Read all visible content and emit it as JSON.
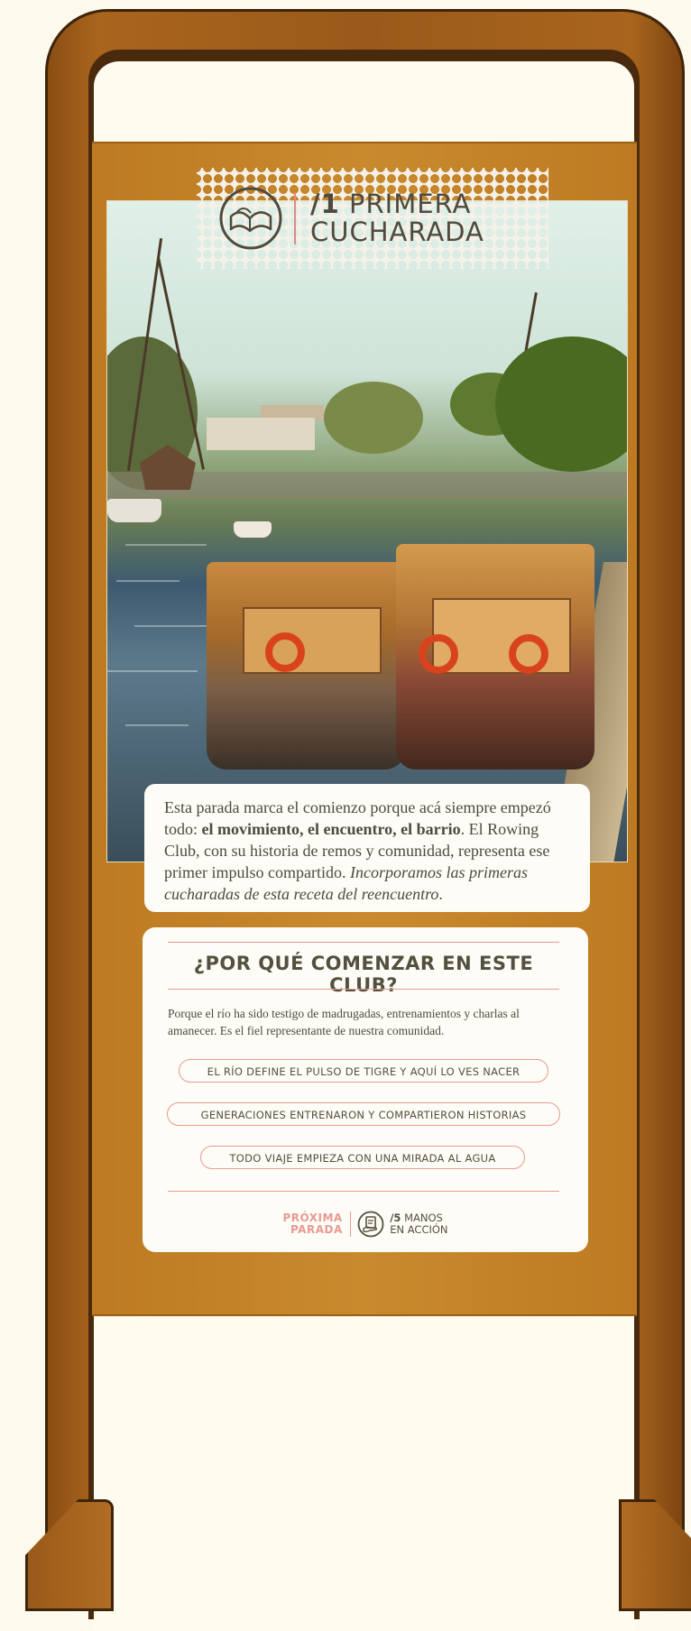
{
  "stamp": {
    "number": "/1",
    "title_line1": "PRIMERA",
    "title_line2": "CUCHARADA",
    "icon": "open-book-logo-icon"
  },
  "photo": {
    "subject": "river-boats-photo"
  },
  "caption": {
    "text_1": "Esta parada marca el comienzo porque acá siempre empezó todo: ",
    "text_bold": "el movimiento, el encuentro, el barrio",
    "text_2": ". El Rowing Club, con su historia de remos y comunidad, representa ese primer impulso compartido. ",
    "text_italic": "Incorporamos las primeras cucharadas de esta receta del reencuentro",
    "text_end": "."
  },
  "card": {
    "heading": "¿POR QUÉ COMENZAR EN ESTE CLUB?",
    "body": "Porque el río ha sido testigo de madrugadas, entrenamientos y charlas al amanecer. Es el fiel representante de nuestra comunidad.",
    "reasons": [
      "EL RÍO DEFINE EL PULSO DE TIGRE Y AQUÍ LO VES NACER",
      "GENERACIONES ENTRENARON Y COMPARTIERON HISTORIAS",
      "TODO VIAJE EMPIEZA CON UNA MIRADA AL AGUA"
    ],
    "next_stop": {
      "label_line1": "PRÓXIMA",
      "label_line2": "PARADA",
      "icon": "hand-note-icon",
      "number": "/5",
      "title_line1": "MANOS",
      "title_line2": "EN ACCIÓN"
    }
  },
  "colors": {
    "frame": "#9a5a1a",
    "panel": "#c98a2e",
    "accent": "#e89a92",
    "text": "#54503f",
    "background": "#fdf9ec"
  }
}
